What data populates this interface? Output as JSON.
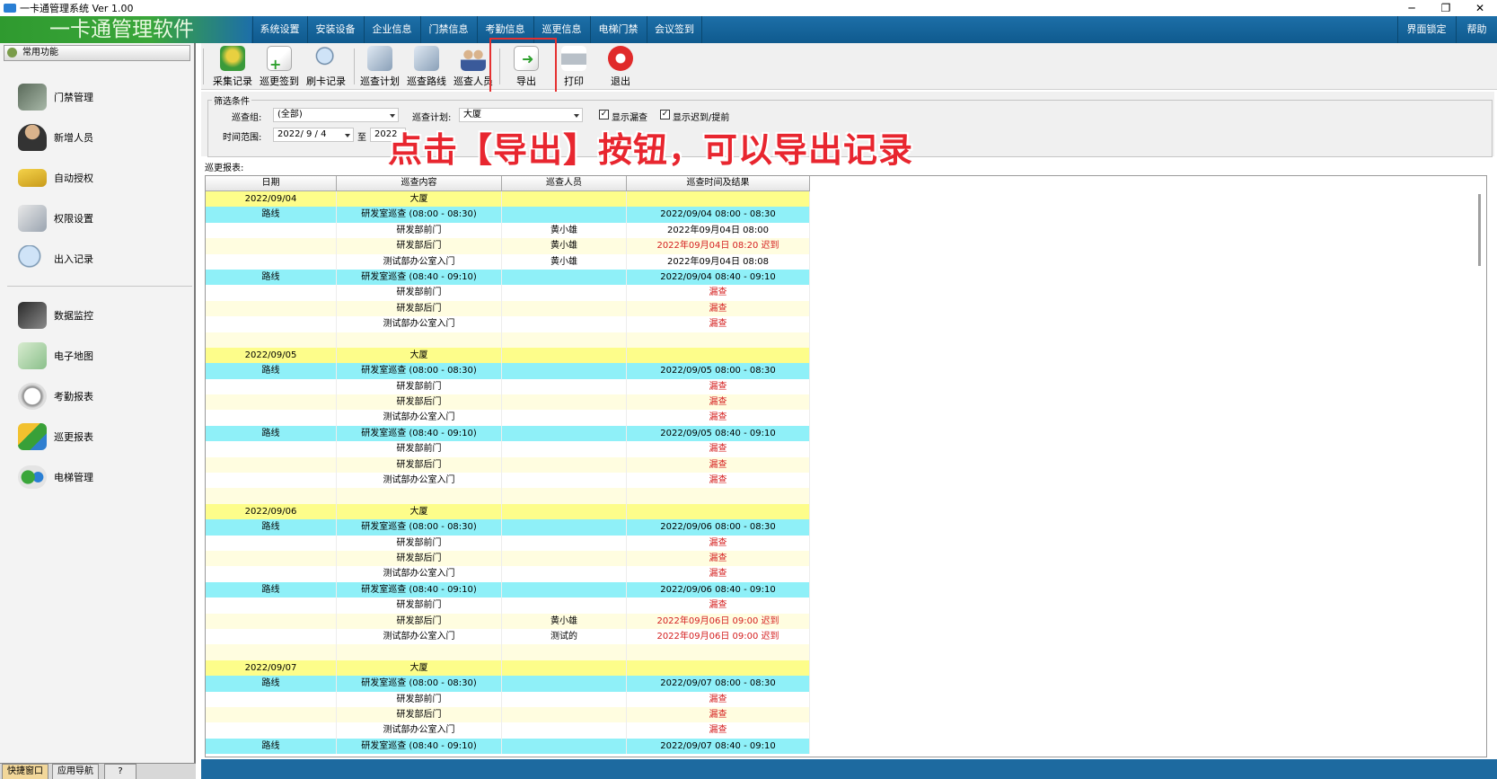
{
  "window": {
    "title": "一卡通管理系统 Ver 1.00"
  },
  "brand": "一卡通管理软件",
  "menu": {
    "items": [
      "系统设置",
      "安装设备",
      "企业信息",
      "门禁信息",
      "考勤信息",
      "巡更信息",
      "电梯门禁",
      "会议签到"
    ],
    "lock": "界面锁定",
    "help": "帮助"
  },
  "sidebar": {
    "header": "常用功能",
    "items": [
      "门禁管理",
      "新增人员",
      "自动授权",
      "权限设置",
      "出入记录",
      "数据监控",
      "电子地图",
      "考勤报表",
      "巡更报表",
      "电梯管理"
    ],
    "tabs": [
      "快捷窗口",
      "应用导航"
    ]
  },
  "toolbar": {
    "buttons": [
      "采集记录",
      "巡更签到",
      "刷卡记录",
      "巡查计划",
      "巡查路线",
      "巡查人员",
      "导出",
      "打印",
      "退出"
    ]
  },
  "filter": {
    "legend": "筛选条件",
    "group_label": "巡查组:",
    "group_value": "(全部)",
    "plan_label": "巡查计划:",
    "plan_value": "大厦",
    "show_missed": "显示漏查",
    "show_late": "显示迟到/提前",
    "range_label": "时间范围:",
    "date_from": "2022/ 9 / 4",
    "to_label": "至",
    "date_to": "2022"
  },
  "annotation": "点击【导出】按钮，可以导出记录",
  "report": {
    "label": "巡更报表:",
    "columns": [
      "日期",
      "巡查内容",
      "巡查人员",
      "巡查时间及结果"
    ],
    "rows": [
      {
        "t": "date",
        "c": [
          "2022/09/04",
          "大厦",
          "",
          ""
        ]
      },
      {
        "t": "route",
        "c": [
          "路线",
          "研发室巡查 (08:00 - 08:30)",
          "",
          "2022/09/04 08:00 - 08:30"
        ]
      },
      {
        "t": "white",
        "c": [
          "",
          "研发部前门",
          "黄小雄",
          "2022年09月04日 08:00"
        ]
      },
      {
        "t": "alt",
        "c": [
          "",
          "研发部后门",
          "黄小雄",
          "2022年09月04日 08:20 迟到"
        ],
        "red": true
      },
      {
        "t": "white",
        "c": [
          "",
          "测试部办公室入门",
          "黄小雄",
          "2022年09月04日 08:08"
        ]
      },
      {
        "t": "route",
        "c": [
          "路线",
          "研发室巡查 (08:40 - 09:10)",
          "",
          "2022/09/04 08:40 - 09:10"
        ]
      },
      {
        "t": "white",
        "c": [
          "",
          "研发部前门",
          "",
          "漏查"
        ],
        "red": true
      },
      {
        "t": "alt",
        "c": [
          "",
          "研发部后门",
          "",
          "漏查"
        ],
        "red": true
      },
      {
        "t": "white",
        "c": [
          "",
          "测试部办公室入门",
          "",
          "漏查"
        ],
        "red": true
      },
      {
        "t": "alt",
        "c": [
          "",
          "",
          "",
          ""
        ]
      },
      {
        "t": "date",
        "c": [
          "2022/09/05",
          "大厦",
          "",
          ""
        ]
      },
      {
        "t": "route",
        "c": [
          "路线",
          "研发室巡查 (08:00 - 08:30)",
          "",
          "2022/09/05 08:00 - 08:30"
        ]
      },
      {
        "t": "white",
        "c": [
          "",
          "研发部前门",
          "",
          "漏查"
        ],
        "red": true
      },
      {
        "t": "alt",
        "c": [
          "",
          "研发部后门",
          "",
          "漏查"
        ],
        "red": true
      },
      {
        "t": "white",
        "c": [
          "",
          "测试部办公室入门",
          "",
          "漏查"
        ],
        "red": true
      },
      {
        "t": "route",
        "c": [
          "路线",
          "研发室巡查 (08:40 - 09:10)",
          "",
          "2022/09/05 08:40 - 09:10"
        ]
      },
      {
        "t": "white",
        "c": [
          "",
          "研发部前门",
          "",
          "漏查"
        ],
        "red": true
      },
      {
        "t": "alt",
        "c": [
          "",
          "研发部后门",
          "",
          "漏查"
        ],
        "red": true
      },
      {
        "t": "white",
        "c": [
          "",
          "测试部办公室入门",
          "",
          "漏查"
        ],
        "red": true
      },
      {
        "t": "alt",
        "c": [
          "",
          "",
          "",
          ""
        ]
      },
      {
        "t": "date",
        "c": [
          "2022/09/06",
          "大厦",
          "",
          ""
        ]
      },
      {
        "t": "route",
        "c": [
          "路线",
          "研发室巡查 (08:00 - 08:30)",
          "",
          "2022/09/06 08:00 - 08:30"
        ]
      },
      {
        "t": "white",
        "c": [
          "",
          "研发部前门",
          "",
          "漏查"
        ],
        "red": true
      },
      {
        "t": "alt",
        "c": [
          "",
          "研发部后门",
          "",
          "漏查"
        ],
        "red": true
      },
      {
        "t": "white",
        "c": [
          "",
          "测试部办公室入门",
          "",
          "漏查"
        ],
        "red": true
      },
      {
        "t": "route",
        "c": [
          "路线",
          "研发室巡查 (08:40 - 09:10)",
          "",
          "2022/09/06 08:40 - 09:10"
        ]
      },
      {
        "t": "white",
        "c": [
          "",
          "研发部前门",
          "",
          "漏查"
        ],
        "red": true
      },
      {
        "t": "alt",
        "c": [
          "",
          "研发部后门",
          "黄小雄",
          "2022年09月06日 09:00 迟到"
        ],
        "red": true
      },
      {
        "t": "white",
        "c": [
          "",
          "测试部办公室入门",
          "测试的",
          "2022年09月06日 09:00 迟到"
        ],
        "red": true
      },
      {
        "t": "alt",
        "c": [
          "",
          "",
          "",
          ""
        ]
      },
      {
        "t": "date",
        "c": [
          "2022/09/07",
          "大厦",
          "",
          ""
        ]
      },
      {
        "t": "route",
        "c": [
          "路线",
          "研发室巡查 (08:00 - 08:30)",
          "",
          "2022/09/07 08:00 - 08:30"
        ]
      },
      {
        "t": "white",
        "c": [
          "",
          "研发部前门",
          "",
          "漏查"
        ],
        "red": true
      },
      {
        "t": "alt",
        "c": [
          "",
          "研发部后门",
          "",
          "漏查"
        ],
        "red": true
      },
      {
        "t": "white",
        "c": [
          "",
          "测试部办公室入门",
          "",
          "漏查"
        ],
        "red": true
      },
      {
        "t": "route",
        "c": [
          "路线",
          "研发室巡查 (08:40 - 09:10)",
          "",
          "2022/09/07 08:40 - 09:10"
        ]
      }
    ]
  }
}
